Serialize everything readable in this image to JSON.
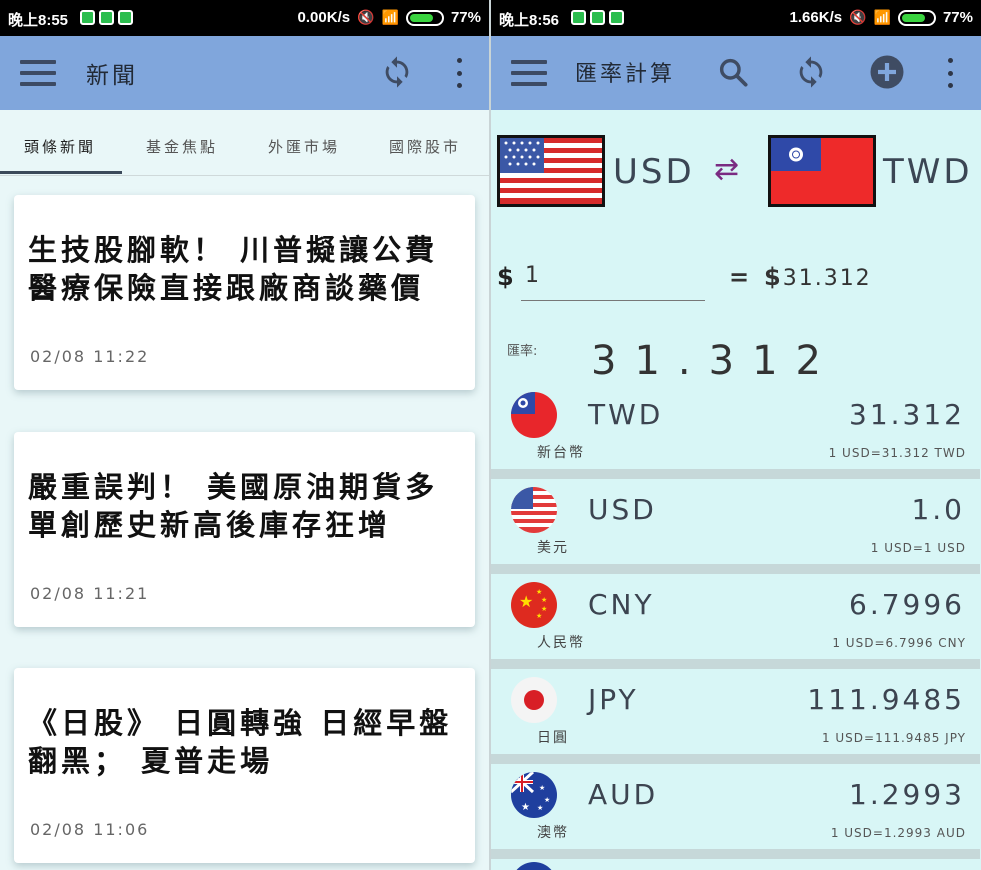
{
  "left": {
    "status": {
      "time": "晚上8:55",
      "net_speed": "0.00K/s",
      "battery": "77%"
    },
    "toolbar": {
      "title": "新聞"
    },
    "tabs": [
      "頭條新聞",
      "基金焦點",
      "外匯市場",
      "國際股市"
    ],
    "cards": [
      {
        "headline": "生技股腳軟！ 川普擬讓公費醫療保險直接跟廠商談藥價",
        "date": "02/08  11:22"
      },
      {
        "headline": "嚴重誤判！ 美國原油期貨多單創歷史新高後庫存狂增",
        "date": "02/08  11:21"
      },
      {
        "headline": "《日股》 日圓轉強 日經早盤翻黑； 夏普走場",
        "date": "02/08  11:06"
      }
    ]
  },
  "right": {
    "status": {
      "time": "晚上8:56",
      "net_speed": "1.66K/s",
      "battery": "77%"
    },
    "toolbar": {
      "title": "匯率計算"
    },
    "from_code": "USD",
    "to_code": "TWD",
    "swap_symbol": "⇄",
    "amount_prefix": "$",
    "amount_value": "1",
    "equals": "=",
    "result_prefix": "$",
    "result_value": "31.312",
    "rate_label": "匯率:",
    "rate_value": "31.312",
    "currencies": [
      {
        "code": "TWD",
        "name": "新台幣",
        "value": "31.312",
        "rate": "1 USD=31.312 TWD"
      },
      {
        "code": "USD",
        "name": "美元",
        "value": "1.0",
        "rate": "1 USD=1 USD"
      },
      {
        "code": "CNY",
        "name": "人民幣",
        "value": "6.7996",
        "rate": "1 USD=6.7996 CNY"
      },
      {
        "code": "JPY",
        "name": "日圓",
        "value": "111.9485",
        "rate": "1 USD=111.9485 JPY"
      },
      {
        "code": "AUD",
        "name": "澳幣",
        "value": "1.2993",
        "rate": "1 USD=1.2993 AUD"
      }
    ]
  },
  "colors": {
    "toolbar": "#80a6dc",
    "news_bg": "#e9f7f8",
    "converter_bg": "#d8f6f6",
    "swap": "#7a2b82"
  }
}
